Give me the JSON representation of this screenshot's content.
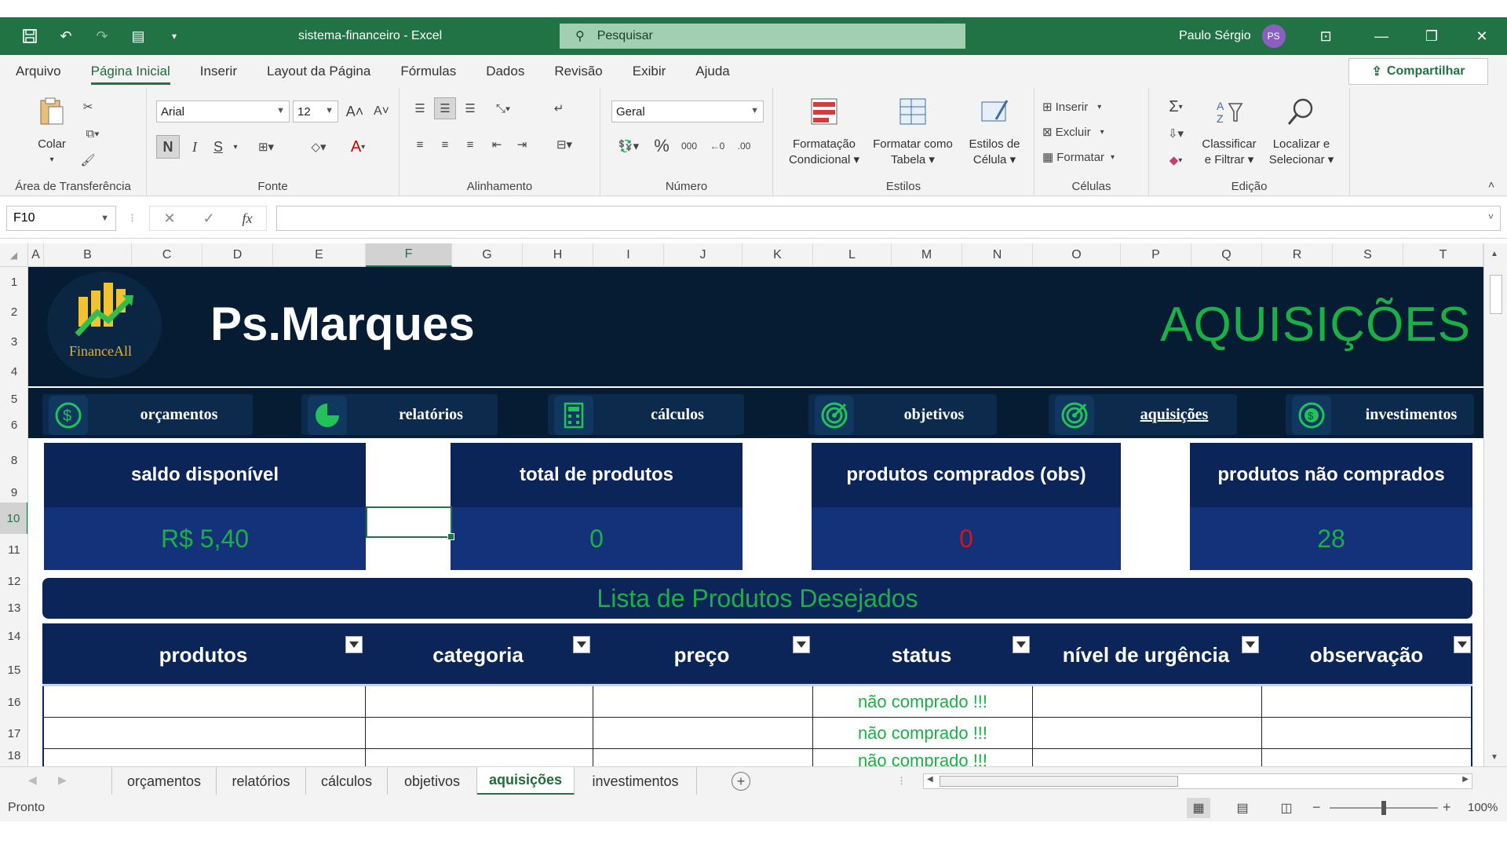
{
  "window": {
    "title": "sistema-financeiro  -  Excel",
    "search_placeholder": "Pesquisar",
    "user_name": "Paulo Sérgio",
    "user_initials": "PS"
  },
  "menu": {
    "tabs": [
      "Arquivo",
      "Página Inicial",
      "Inserir",
      "Layout da Página",
      "Fórmulas",
      "Dados",
      "Revisão",
      "Exibir",
      "Ajuda"
    ],
    "share": "Compartilhar"
  },
  "ribbon": {
    "clipboard": {
      "paste": "Colar",
      "label": "Área de Transferência"
    },
    "font": {
      "name": "Arial",
      "size": "12",
      "bold": "N",
      "italic": "I",
      "underline": "S",
      "label": "Fonte"
    },
    "alignment": {
      "label": "Alinhamento"
    },
    "number": {
      "format": "Geral",
      "label": "Número"
    },
    "styles": {
      "conditional_1": "Formatação",
      "conditional_2": "Condicional",
      "table_1": "Formatar como",
      "table_2": "Tabela",
      "cell_1": "Estilos de",
      "cell_2": "Célula",
      "label": "Estilos"
    },
    "cells": {
      "insert": "Inserir",
      "delete": "Excluir",
      "format": "Formatar",
      "label": "Células"
    },
    "editing": {
      "sort_1": "Classificar",
      "sort_2": "e Filtrar",
      "find_1": "Localizar e",
      "find_2": "Selecionar",
      "label": "Edição"
    }
  },
  "formula_bar": {
    "name_box": "F10",
    "fx": "fx",
    "value": ""
  },
  "columns": [
    "A",
    "B",
    "C",
    "D",
    "E",
    "F",
    "G",
    "H",
    "I",
    "J",
    "K",
    "L",
    "M",
    "N",
    "O",
    "P",
    "Q",
    "R",
    "S",
    "T"
  ],
  "rows": [
    "1",
    "2",
    "3",
    "4",
    "5",
    "6",
    "8",
    "9",
    "10",
    "11",
    "12",
    "13",
    "14",
    "15",
    "16",
    "17",
    "18"
  ],
  "sheet": {
    "brand": "Ps.Marques",
    "logo_text": "FinanceAll",
    "page_title": "AQUISIÇÕES",
    "nav": [
      "orçamentos",
      "relatórios",
      "cálculos",
      "objetivos",
      "aquisições",
      "investimentos"
    ],
    "cards": [
      {
        "title": "saldo disponível",
        "value": "R$ 5,40"
      },
      {
        "title": "total de produtos",
        "value": "0"
      },
      {
        "title": "produtos comprados (obs)",
        "value": "0"
      },
      {
        "title": "produtos não comprados",
        "value": "28"
      }
    ],
    "list_title": "Lista de Produtos Desejados",
    "table_headers": [
      "produtos",
      "categoria",
      "preço",
      "status",
      "nível de urgência",
      "observação"
    ],
    "table_rows": [
      [
        "",
        "",
        "",
        "não comprado !!!",
        "",
        ""
      ],
      [
        "",
        "",
        "",
        "não comprado !!!",
        "",
        ""
      ],
      [
        "",
        "",
        "",
        "não comprado !!!",
        "",
        ""
      ]
    ]
  },
  "sheet_tabs": [
    "orçamentos",
    "relatórios",
    "cálculos",
    "objetivos",
    "aquisições",
    "investimentos"
  ],
  "status": {
    "ready": "Pronto",
    "zoom": "100%"
  },
  "colors": {
    "excel_green": "#217346",
    "banner_navy": "#061c33",
    "card_navy": "#0b2559",
    "accent_green": "#1bb046",
    "value_red": "#d01818"
  }
}
